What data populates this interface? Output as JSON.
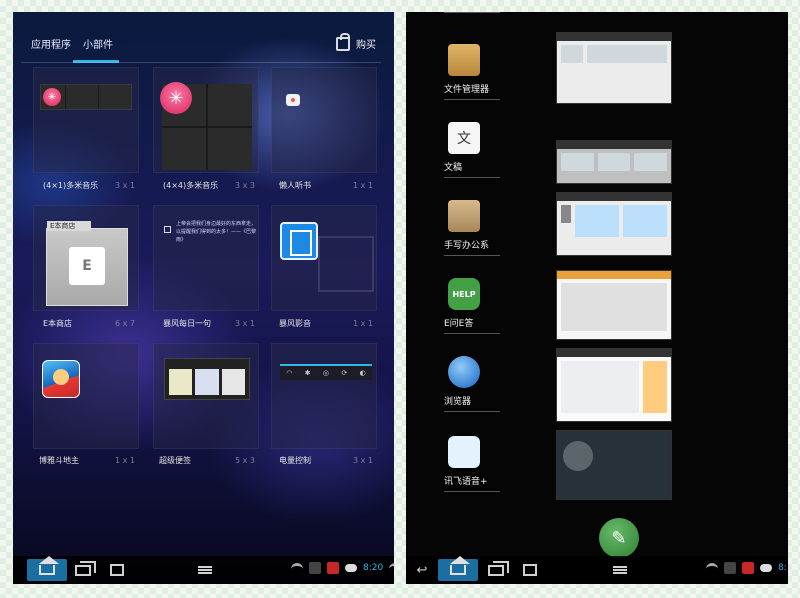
{
  "left": {
    "tabs": [
      "应用程序",
      "小部件"
    ],
    "buy_label": "购买",
    "widgets": [
      {
        "label": "(4×1)多米音乐",
        "size": "3 x 1"
      },
      {
        "label": "(4×4)多米音乐",
        "size": "3 x 3"
      },
      {
        "label": "懒人听书",
        "size": "1 x 1"
      },
      {
        "label": "E本商店",
        "size": "6 x 7",
        "badge": "E本商店"
      },
      {
        "label": "暴风每日一句",
        "size": "3 x 1",
        "preview_text": "上帝会把我们身边最好的东西拿走，以提醒我们得到的太多！——《巴黎雨》"
      },
      {
        "label": "暴风影音",
        "size": "1 x 1"
      },
      {
        "label": "博雅斗地主",
        "size": "1 x 1"
      },
      {
        "label": "超级便签",
        "size": "5 x 3"
      },
      {
        "label": "电量控制",
        "size": "3 x 1"
      }
    ],
    "clock": "8:20"
  },
  "right": {
    "apps": [
      {
        "label": "文件管理器"
      },
      {
        "label": "文稿",
        "glyph": "文"
      },
      {
        "label": "手写办公系"
      },
      {
        "label": "E问E答",
        "glyph": "HELP"
      },
      {
        "label": "浏览器"
      },
      {
        "label": "讯飞语音+"
      }
    ],
    "clock": "8:"
  },
  "colors": {
    "accent": "#33b5e5",
    "fab": "#2e7d32"
  }
}
